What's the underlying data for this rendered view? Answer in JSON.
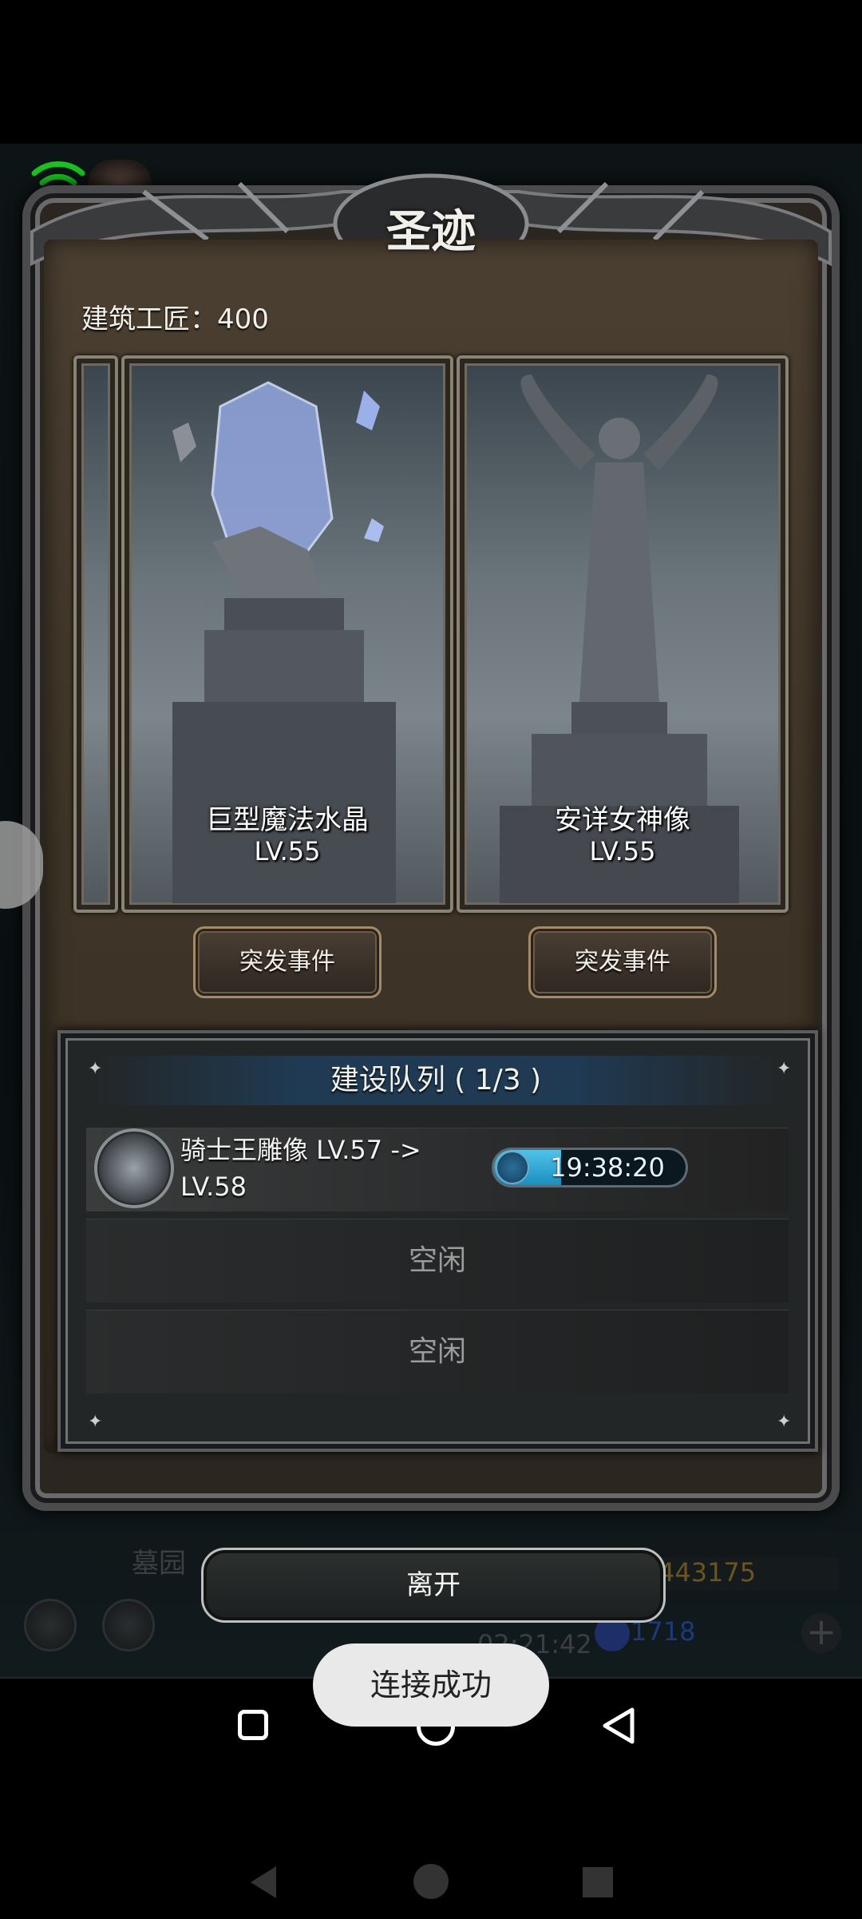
{
  "dialog": {
    "title": "圣迹",
    "craftsman_label": "建筑工匠：400"
  },
  "cards": [
    {
      "name": "巨型魔法水晶",
      "level": "LV.55",
      "event_label": "突发事件"
    },
    {
      "name": "安详女神像",
      "level": "LV.55",
      "event_label": "突发事件"
    }
  ],
  "queue": {
    "header": "建设队列 ( 1/3 )",
    "active": {
      "name": "骑士王雕像 LV.57 -> LV.58",
      "timer": "19:38:20",
      "progress": 0.35
    },
    "idle_slots": [
      "空闲",
      "空闲"
    ]
  },
  "leave_label": "离开",
  "background": {
    "graveyard": "墓园",
    "resource_gold": "443175",
    "resource_gem": "1718",
    "clock": "02:21:42"
  },
  "toast": "连接成功",
  "icons": {
    "wifi": "wifi-icon",
    "timer": "timer-icon",
    "plus": "plus-icon"
  }
}
